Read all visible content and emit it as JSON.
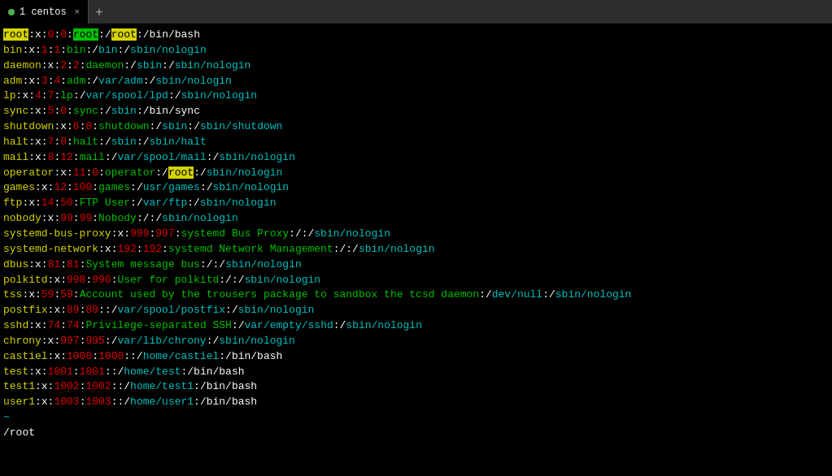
{
  "tab": {
    "label": "1 centos",
    "close": "×",
    "add": "+"
  },
  "terminal": {
    "lines": [
      {
        "id": "line1",
        "text": "root:x:0:0:root:/root:/bin/bash"
      },
      {
        "id": "line2",
        "text": "bin:x:1:1:bin:/bin:/sbin/nologin"
      },
      {
        "id": "line3",
        "text": "daemon:x:2:2:daemon:/sbin:/sbin/nologin"
      },
      {
        "id": "line4",
        "text": "adm:x:3:4:adm:/var/adm:/sbin/nologin"
      },
      {
        "id": "line5",
        "text": "lp:x:4:7:lp:/var/spool/lpd:/sbin/nologin"
      },
      {
        "id": "line6",
        "text": "sync:x:5:0:sync:/sbin:/bin/sync"
      },
      {
        "id": "line7",
        "text": "shutdown:x:6:0:shutdown:/sbin:/sbin/shutdown"
      },
      {
        "id": "line8",
        "text": "halt:x:7:0:halt:/sbin:/sbin/halt"
      },
      {
        "id": "line9",
        "text": "mail:x:8:12:mail:/var/spool/mail:/sbin/nologin"
      },
      {
        "id": "line10",
        "text": "operator:x:11:0:operator:/root:/sbin/nologin"
      },
      {
        "id": "line11",
        "text": "games:x:12:100:games:/usr/games:/sbin/nologin"
      },
      {
        "id": "line12",
        "text": "ftp:x:14:50:FTP User:/var/ftp:/sbin/nologin"
      },
      {
        "id": "line13",
        "text": "nobody:x:99:99:Nobody:/:/sbin/nologin"
      },
      {
        "id": "line14",
        "text": "systemd-bus-proxy:x:999:997:systemd Bus Proxy:/:/sbin/nologin"
      },
      {
        "id": "line15",
        "text": "systemd-network:x:192:192:systemd Network Management:/:/sbin/nologin"
      },
      {
        "id": "line16",
        "text": "dbus:x:81:81:System message bus:/:/sbin/nologin"
      },
      {
        "id": "line17",
        "text": "polkitd:x:998:996:User for polkitd:/:/sbin/nologin"
      },
      {
        "id": "line18",
        "text": "tss:x:59:59:Account used by the trousers package to sandbox the tcsd daemon:/dev/null:/sbin/nologin"
      },
      {
        "id": "line19",
        "text": "postfix:x:89:89::/var/spool/postfix:/sbin/nologin"
      },
      {
        "id": "line20",
        "text": "sshd:x:74:74:Privilege-separated SSH:/var/empty/sshd:/sbin/nologin"
      },
      {
        "id": "line21",
        "text": "chrony:x:997:995:/var/lib/chrony:/sbin/nologin"
      },
      {
        "id": "line22",
        "text": "castiel:x:1000:1000::/home/castiel:/bin/bash"
      },
      {
        "id": "line23",
        "text": "test:x:1001:1001::/home/test:/bin/bash"
      },
      {
        "id": "line24",
        "text": "test1:x:1002:1002::/home/test1:/bin/bash"
      },
      {
        "id": "line25",
        "text": "user1:x:1003:1003::/home/user1:/bin/bash"
      },
      {
        "id": "line26",
        "text": "~"
      },
      {
        "id": "line27",
        "text": "/root"
      }
    ]
  }
}
